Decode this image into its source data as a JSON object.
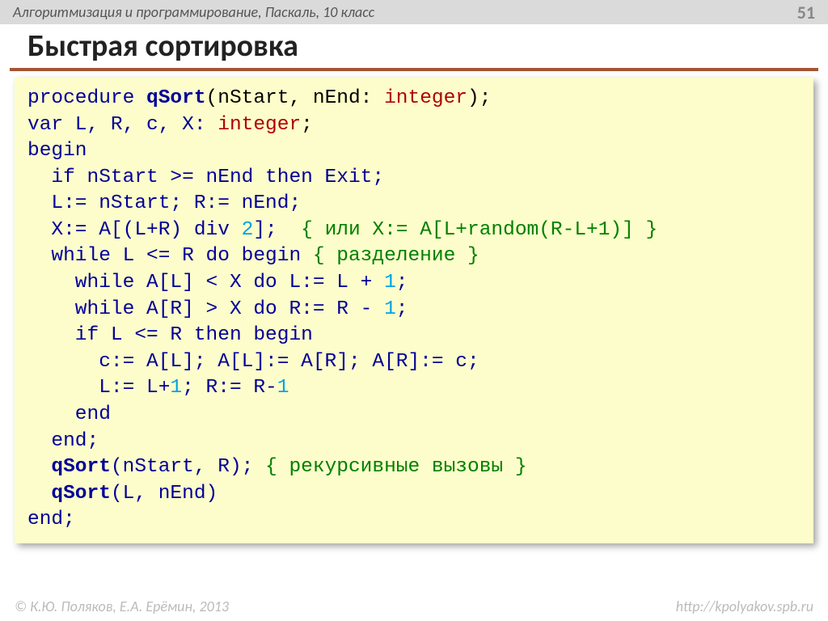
{
  "header": {
    "subject": "Алгоритмизация и программирование, Паскаль, 10 класс",
    "page": "51"
  },
  "title": "Быстрая сортировка",
  "code": {
    "l1_a": "procedure ",
    "l1_b": "qSort",
    "l1_c": "(nStart, nEnd: ",
    "l1_d": "integer",
    "l1_e": ");",
    "l2_a": "var L, R, c, X: ",
    "l2_b": "integer",
    "l2_c": ";",
    "l3": "begin",
    "l4": "  if nStart >= nEnd then Exit;",
    "l5": "  L:= nStart; R:= nEnd;",
    "l6_a": "  X:= A[(L+R) ",
    "l6_b": "div",
    "l6_c": " ",
    "l6_d": "2",
    "l6_e": "];  ",
    "l6_f": "{ или X:= A[L+random(R-L+1)] }",
    "l7_a": "  while L <= R do begin ",
    "l7_b": "{ разделение }",
    "l8_a": "    while A[L] < X do L:= L + ",
    "l8_b": "1",
    "l8_c": ";",
    "l9_a": "    while A[R] > X do R:= R - ",
    "l9_b": "1",
    "l9_c": ";",
    "l10": "    if L <= R then begin",
    "l11": "      c:= A[L]; A[L]:= A[R]; A[R]:= c;",
    "l12_a": "      L:= L+",
    "l12_b": "1",
    "l12_c": "; R:= R-",
    "l12_d": "1",
    "l13": "    end",
    "l14": "  end;",
    "l15_a": "  ",
    "l15_b": "qSort",
    "l15_c": "(nStart, R); ",
    "l15_d": "{ рекурсивные вызовы }",
    "l16_a": "  ",
    "l16_b": "qSort",
    "l16_c": "(L, nEnd)",
    "l17": "end;"
  },
  "footer": {
    "left": "© К.Ю. Поляков, Е.А. Ерёмин, 2013",
    "right": "http://kpolyakov.spb.ru"
  }
}
